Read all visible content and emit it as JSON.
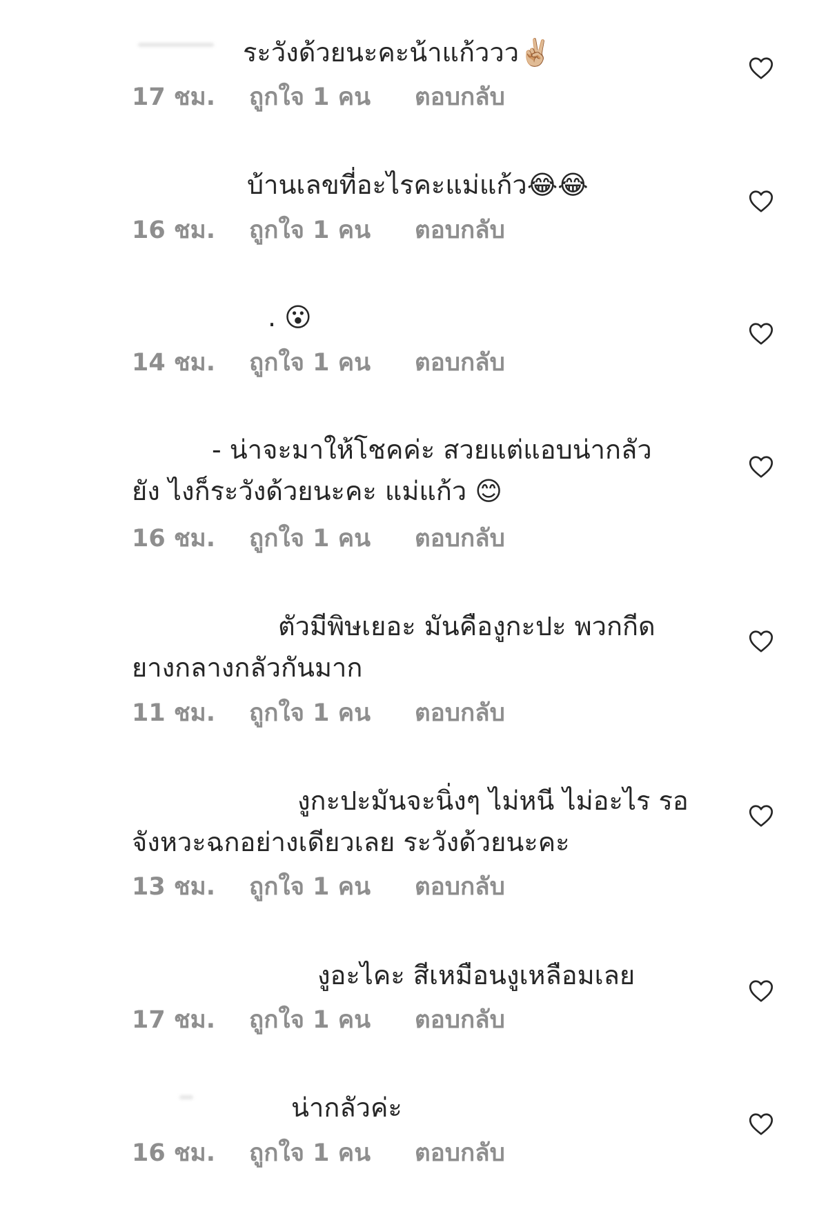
{
  "comments": [
    {
      "text": "ระวังด้วยนะคะน้าแก้ววว✌🏼",
      "time": "17 ชม.",
      "likes": "ถูกใจ 1 คน",
      "reply": "ตอบกลับ"
    },
    {
      "text": "บ้านเลขที่อะไรคะแม่แก้ว😂😂",
      "time": "16 ชม.",
      "likes": "ถูกใจ 1 คน",
      "reply": "ตอบกลับ"
    },
    {
      "text": ". 😮",
      "time": "14 ชม.",
      "likes": "ถูกใจ 1 คน",
      "reply": "ตอบกลับ"
    },
    {
      "text": "- น่าจะมาให้โชคค่ะ สวยแต่แอบน่ากลัว\nยัง ไงก็ระวังด้วยนะคะ แม่แก้ว 😊",
      "time": "16 ชม.",
      "likes": "ถูกใจ 1 คน",
      "reply": "ตอบกลับ"
    },
    {
      "text": "ตัวมีพิษเยอะ มันคืองูกะปะ พวกกีด\nยางกลางกลัวกันมาก",
      "time": "11 ชม.",
      "likes": "ถูกใจ 1 คน",
      "reply": "ตอบกลับ"
    },
    {
      "text": "งูกะปะมันจะนิ่งๆ ไม่หนี ไม่อะไร รอ\nจังหวะฉกอย่างเดียวเลย ระวังด้วยนะคะ",
      "time": "13 ชม.",
      "likes": "ถูกใจ 1 คน",
      "reply": "ตอบกลับ"
    },
    {
      "text": "งูอะไคะ สีเหมือนงูเหลือมเลย",
      "time": "17 ชม.",
      "likes": "ถูกใจ 1 คน",
      "reply": "ตอบกลับ"
    },
    {
      "text": "น่ากลัวค่ะ",
      "time": "16 ชม.",
      "likes": "ถูกใจ 1 คน",
      "reply": "ตอบกลับ"
    }
  ],
  "icons": {
    "like": "heart-outline-icon"
  }
}
